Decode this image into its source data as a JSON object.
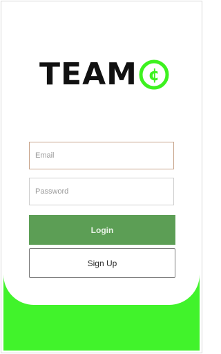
{
  "logo": {
    "wordmark": "TEAM",
    "mark_glyph": "¢",
    "wordmark_color": "#111111",
    "mark_color": "#3df21f"
  },
  "form": {
    "email_placeholder": "Email",
    "password_placeholder": "Password",
    "login_label": "Login",
    "signup_label": "Sign Up"
  },
  "colors": {
    "accent_band": "#41f32b",
    "login_button": "#5c9e55"
  }
}
